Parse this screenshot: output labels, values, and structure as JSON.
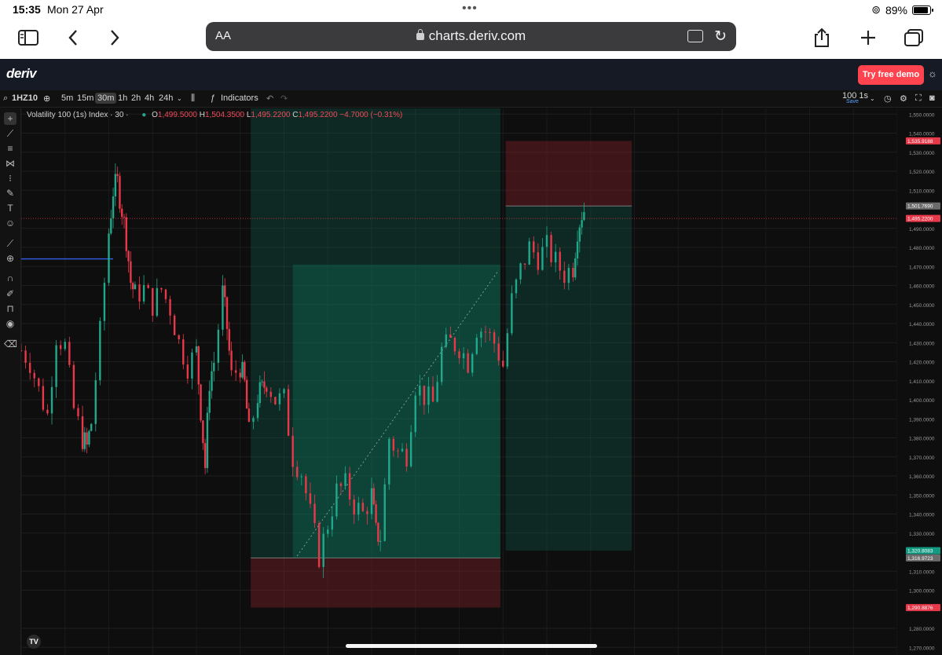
{
  "status": {
    "time": "15:35",
    "date": "Mon 27 Apr",
    "battery": "89%"
  },
  "safari": {
    "aa": "AA",
    "url": "charts.deriv.com"
  },
  "header": {
    "logo": "deriv",
    "cta": "Try free demo"
  },
  "toolbar": {
    "symbol": "1HZ10",
    "timeframes": [
      "5m",
      "15m",
      "30m",
      "1h",
      "2h",
      "4h",
      "24h"
    ],
    "active_timeframe": "30m",
    "indicators": "Indicators",
    "interval": "100 1s",
    "save": "Save"
  },
  "legend": {
    "name": "Volatility 100 (1s) Index · 30 ·",
    "o_label": "O",
    "o": "1,499.5000",
    "h_label": "H",
    "h": "1,504.3500",
    "l_label": "L",
    "l": "1,495.2200",
    "c_label": "C",
    "c": "1,495.2200",
    "change": "−4.7000 (−0.31%)"
  },
  "tv_logo": "TV",
  "chart_data": {
    "type": "candlestick",
    "y_axis": {
      "ticks": [
        "1,550.0000",
        "1,540.0000",
        "1,530.0000",
        "1,520.0000",
        "1,510.0000",
        "1,490.0000",
        "1,480.0000",
        "1,470.0000",
        "1,460.0000",
        "1,450.0000",
        "1,440.0000",
        "1,430.0000",
        "1,420.0000",
        "1,410.0000",
        "1,400.0000",
        "1,390.0000",
        "1,380.0000",
        "1,370.0000",
        "1,360.0000",
        "1,350.0000",
        "1,340.0000",
        "1,330.0000",
        "1,310.0000",
        "1,300.0000",
        "1,280.0000",
        "1,270.0000"
      ],
      "ylim": [
        1266,
        1553
      ]
    },
    "price_labels": [
      {
        "label": "1,535.9188",
        "value": 1535.9188,
        "color": "#e8394a"
      },
      {
        "label": "1,501.7690",
        "value": 1501.769,
        "color": "#6b6b6b"
      },
      {
        "label": "1,495.2200",
        "value": 1495.22,
        "color": "#e8394a"
      },
      {
        "label": "1,320.8083",
        "value": 1320.8083,
        "color": "#129b82"
      },
      {
        "label": "1,316.9723",
        "value": 1316.9723,
        "color": "#6b6b6b"
      },
      {
        "label": "1,290.8876",
        "value": 1290.8876,
        "color": "#e8394a"
      }
    ],
    "close_line": 1495.22,
    "horizontal_line": 1474,
    "positions": [
      {
        "kind": "long",
        "entry": 1316.9723,
        "target": 1553,
        "stop": 1290.8876,
        "x_start": 0.262,
        "x_end": 0.547
      },
      {
        "kind": "short",
        "entry": 1501.769,
        "target": 1320.8083,
        "stop": 1535.9188,
        "x_start": 0.553,
        "x_end": 0.697
      }
    ],
    "inner_zone": {
      "top": 1471,
      "bottom": 1316.9723,
      "x_start": 0.31,
      "x_end": 0.547
    },
    "price_path": [
      [
        0,
        1426
      ],
      [
        0.01,
        1420
      ],
      [
        0.02,
        1405
      ],
      [
        0.03,
        1392
      ],
      [
        0.04,
        1434
      ],
      [
        0.05,
        1428
      ],
      [
        0.06,
        1395
      ],
      [
        0.07,
        1380
      ],
      [
        0.075,
        1375
      ],
      [
        0.08,
        1388
      ],
      [
        0.09,
        1435
      ],
      [
        0.1,
        1488
      ],
      [
        0.105,
        1510
      ],
      [
        0.11,
        1514
      ],
      [
        0.115,
        1500
      ],
      [
        0.12,
        1485
      ],
      [
        0.125,
        1462
      ],
      [
        0.13,
        1455
      ],
      [
        0.14,
        1458
      ],
      [
        0.15,
        1450
      ],
      [
        0.16,
        1458
      ],
      [
        0.17,
        1448
      ],
      [
        0.18,
        1430
      ],
      [
        0.19,
        1418
      ],
      [
        0.2,
        1425
      ],
      [
        0.205,
        1395
      ],
      [
        0.21,
        1365
      ],
      [
        0.215,
        1410
      ],
      [
        0.22,
        1420
      ],
      [
        0.23,
        1456
      ],
      [
        0.235,
        1438
      ],
      [
        0.24,
        1412
      ],
      [
        0.25,
        1418
      ],
      [
        0.255,
        1408
      ],
      [
        0.26,
        1382
      ],
      [
        0.27,
        1402
      ],
      [
        0.275,
        1405
      ],
      [
        0.28,
        1410
      ],
      [
        0.29,
        1400
      ],
      [
        0.3,
        1400
      ],
      [
        0.31,
        1370
      ],
      [
        0.32,
        1362
      ],
      [
        0.33,
        1340
      ],
      [
        0.34,
        1318
      ],
      [
        0.35,
        1335
      ],
      [
        0.36,
        1352
      ],
      [
        0.37,
        1355
      ],
      [
        0.38,
        1345
      ],
      [
        0.39,
        1340
      ],
      [
        0.4,
        1350
      ],
      [
        0.405,
        1330
      ],
      [
        0.41,
        1328
      ],
      [
        0.42,
        1380
      ],
      [
        0.43,
        1372
      ],
      [
        0.44,
        1372
      ],
      [
        0.45,
        1408
      ],
      [
        0.46,
        1402
      ],
      [
        0.47,
        1398
      ],
      [
        0.48,
        1426
      ],
      [
        0.49,
        1430
      ],
      [
        0.5,
        1428
      ],
      [
        0.51,
        1420
      ],
      [
        0.52,
        1438
      ],
      [
        0.53,
        1436
      ],
      [
        0.54,
        1430
      ],
      [
        0.55,
        1418
      ],
      [
        0.56,
        1452
      ],
      [
        0.57,
        1468
      ],
      [
        0.58,
        1480
      ],
      [
        0.59,
        1475
      ],
      [
        0.6,
        1480
      ],
      [
        0.61,
        1472
      ],
      [
        0.62,
        1466
      ],
      [
        0.63,
        1470
      ],
      [
        0.635,
        1490
      ],
      [
        0.64,
        1498
      ],
      [
        0.645,
        1502
      ]
    ]
  }
}
